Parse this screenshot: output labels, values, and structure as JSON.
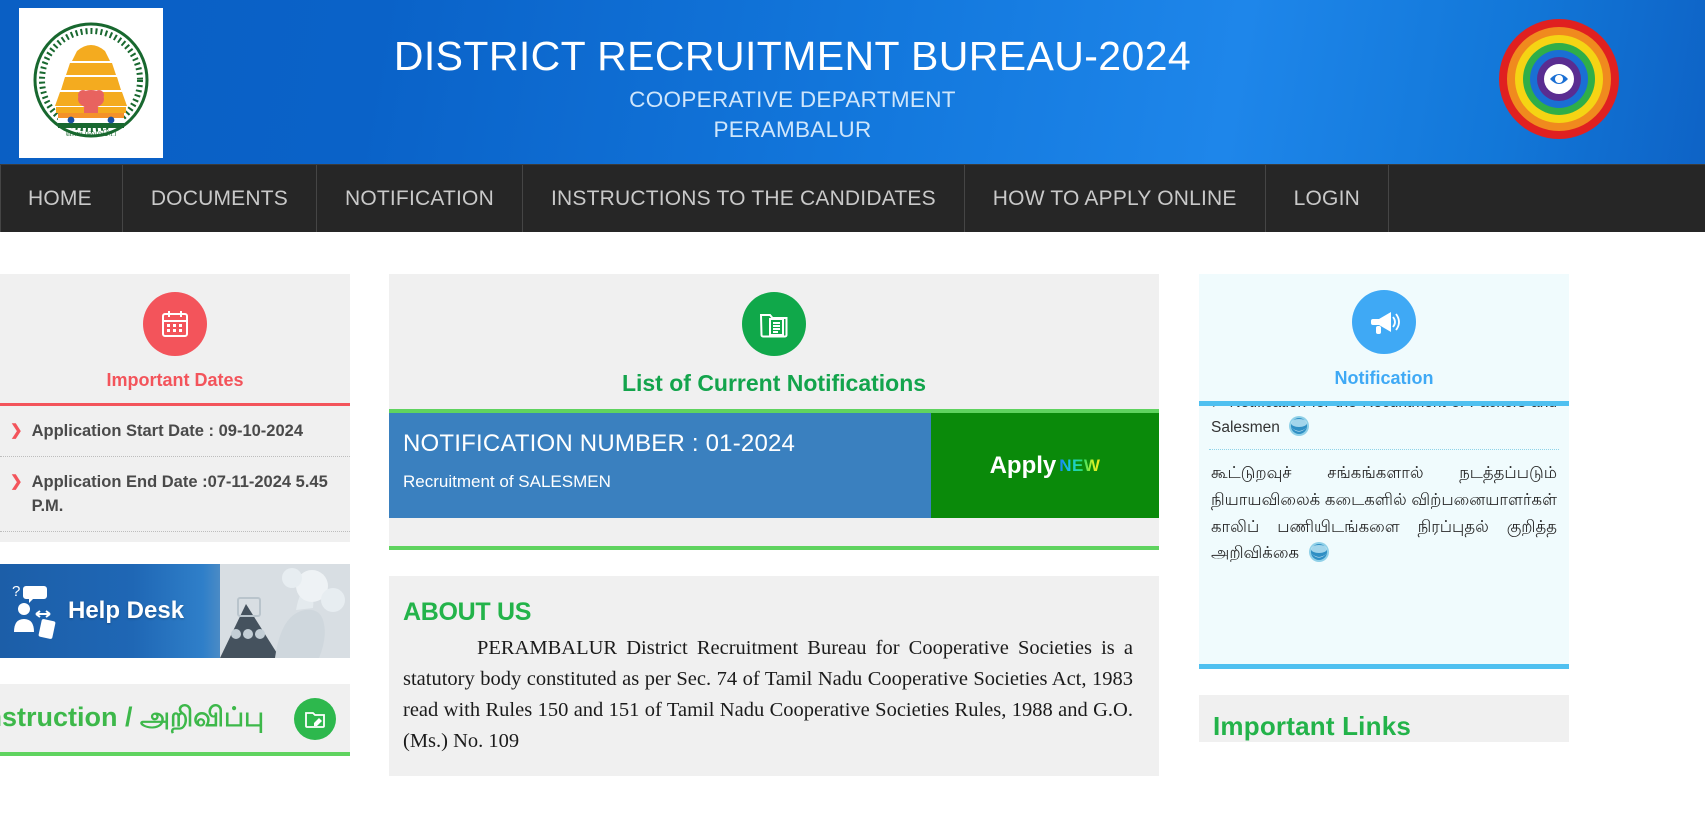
{
  "header": {
    "title": "DISTRICT RECRUITMENT BUREAU-2024",
    "subtitle": "COOPERATIVE DEPARTMENT",
    "location": "PERAMBALUR",
    "emblem_alt": "tamil-nadu-government-emblem",
    "logo_alt": "cooperative-department-logo",
    "bg_color": "#0a62c8"
  },
  "nav": {
    "items": [
      {
        "label": "HOME"
      },
      {
        "label": "DOCUMENTS"
      },
      {
        "label": "NOTIFICATION"
      },
      {
        "label": "INSTRUCTIONS TO THE CANDIDATES"
      },
      {
        "label": "HOW TO APPLY ONLINE"
      },
      {
        "label": "LOGIN"
      }
    ],
    "bg_color": "#262626"
  },
  "left": {
    "dates": {
      "icon": "calendar-icon",
      "heading": "Important Dates",
      "accent_color": "#f3545b",
      "items": [
        {
          "label": "Application Start Date : 09-10-2024"
        },
        {
          "label": "Application End Date :07-11-2024 5.45 P.M."
        }
      ]
    },
    "helpdesk": {
      "label": "Help Desk",
      "icon": "help-desk-icon"
    },
    "instruction": {
      "title_en": "Instruction / ",
      "title_ta": "அறிவிப்பு",
      "icon": "document-edit-icon",
      "accent_color": "#3db84a"
    }
  },
  "center": {
    "notifications": {
      "icon": "documents-icon",
      "heading": "List of Current Notifications",
      "accent_color": "#13a44c",
      "rows": [
        {
          "number": "NOTIFICATION NUMBER : 01-2024",
          "subtitle": "Recruitment of SALESMEN",
          "apply_label": "Apply",
          "badge": "NEW"
        }
      ]
    },
    "about": {
      "title": "ABOUT US",
      "body": "PERAMBALUR District Recruitment Bureau for Cooperative Societies is a statutory body constituted as per Sec. 74 of Tamil Nadu Cooperative Societies Act, 1983 read with Rules 150 and 151 of Tamil Nadu Cooperative Societies Rules, 1988 and G.O.(Ms.) No. 109"
    }
  },
  "right": {
    "notification": {
      "icon": "megaphone-icon",
      "heading": "Notification",
      "accent_color": "#3fa9f5",
      "marquee": [
        {
          "type": "en",
          "bullet": "➤",
          "text": "Notification for the Recuritment of Packers and Salesmen",
          "icon": "globe-icon"
        },
        {
          "type": "ta",
          "text": "கூட்டுறவுச் சங்கங்களால் நடத்தப்படும் நியாயவிலைக் கடைகளில் விற்பனையாளர்கள் காலிப் பணியிடங்களை நிரப்புதல் குறித்த அறிவிக்கை",
          "icon": "globe-icon"
        }
      ]
    },
    "links": {
      "title": "Important Links",
      "accent_color": "#23b34a"
    }
  }
}
